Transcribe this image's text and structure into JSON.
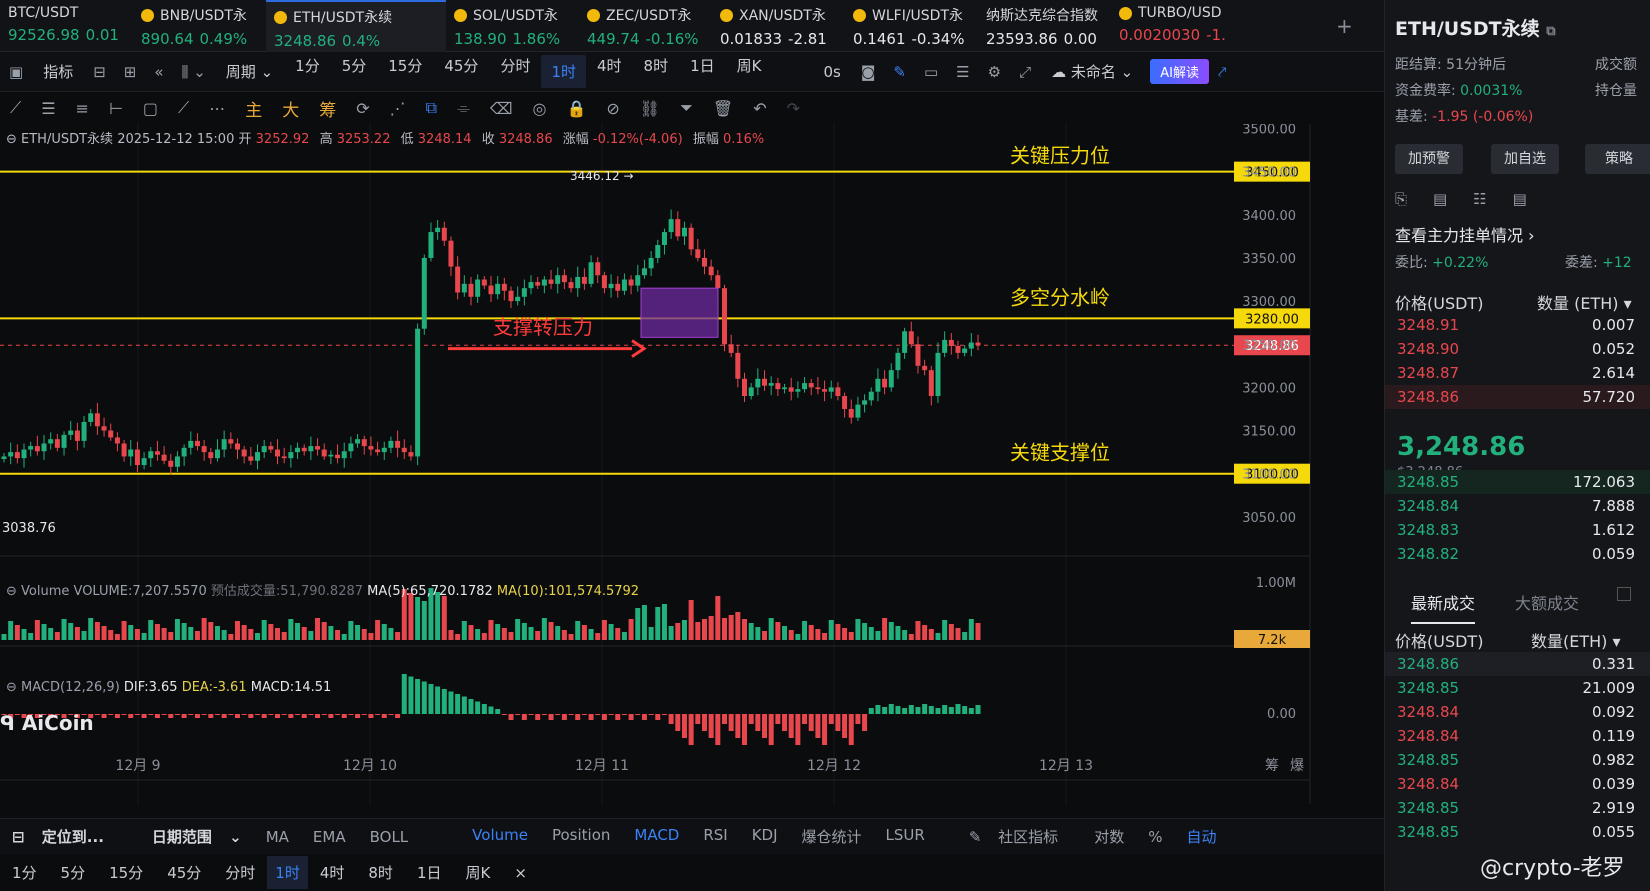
{
  "tickers": [
    {
      "name": "BTC/USDT",
      "price": "92526.98",
      "change": "0.01",
      "dir": "up"
    },
    {
      "name": "BNB/USDT永",
      "price": "890.64",
      "change": "0.49%",
      "dir": "up"
    },
    {
      "name": "ETH/USDT永续",
      "price": "3248.86",
      "change": "0.4%",
      "dir": "up"
    },
    {
      "name": "SOL/USDT永",
      "price": "138.90",
      "change": "1.86%",
      "dir": "up"
    },
    {
      "name": "ZEC/USDT永",
      "price": "449.74",
      "change": "-0.16%",
      "dir": "up"
    },
    {
      "name": "XAN/USDT永",
      "price": "0.01833",
      "change": "-2.81",
      "dir": "wh"
    },
    {
      "name": "WLFI/USDT永",
      "price": "0.1461",
      "change": "-0.34%",
      "dir": "wh"
    },
    {
      "name": "纳斯达克综合指数",
      "price": "23593.86",
      "change": "0.00",
      "dir": "wh"
    },
    {
      "name": "TURBO/USD",
      "price": "0.0020030",
      "change": "-1.",
      "dir": "dn"
    }
  ],
  "toolbar1": {
    "indicator": "指标",
    "period": "周期",
    "intervals": [
      "1分",
      "5分",
      "15分",
      "45分",
      "分时",
      "1时",
      "4时",
      "8时",
      "1日",
      "周K"
    ],
    "selected": "1时",
    "countdown": "0s",
    "unnamed": "未命名",
    "ai": "AI解读"
  },
  "toolbar2": {
    "main": "主",
    "big": "大",
    "chips": "筹"
  },
  "info": {
    "symbol": "ETH/USDT永续",
    "datetime": "2025-12-12 15:00",
    "open_l": "开",
    "open": "3252.92",
    "high_l": "高",
    "high": "3253.22",
    "low_l": "低",
    "low": "3248.14",
    "close_l": "收",
    "close": "3248.86",
    "chg_l": "涨幅",
    "chg": "-0.12%(-4.06)",
    "amp_l": "振幅",
    "amp": "0.16%"
  },
  "volume": {
    "label": "Volume",
    "vol": "VOLUME:7,207.5570",
    "est": "预估成交量:51,790.8287",
    "ma5": "MA(5):65,720.1782",
    "ma10": "MA(10):101,574.5792",
    "axis": "1.00M",
    "last": "7.2k"
  },
  "macd": {
    "label": "MACD(12,26,9)",
    "dif": "DIF:3.65",
    "dea": "DEA:-3.61",
    "macd": "MACD:14.51",
    "axis": "0.00"
  },
  "annotations": {
    "resistance": "关键压力位",
    "pivot": "多空分水岭",
    "support": "关键支撑位",
    "flip": "支撑转压力",
    "high_mark": "3446.12 →",
    "low_mark": "3038.76"
  },
  "levels": {
    "resistance": "3450.00",
    "pivot": "3280.00",
    "current": "3248.86",
    "support": "3100.00"
  },
  "price_ticks": [
    "3500.00",
    "3450.00",
    "3400.00",
    "3350.00",
    "3300.00",
    "3250.00",
    "3200.00",
    "3150.00",
    "3100.00",
    "3050.00"
  ],
  "date_ticks": [
    "12月 9",
    "12月 10",
    "12月 11",
    "12月 12",
    "12月 13"
  ],
  "logo": "AiCoin",
  "bottom1": {
    "locate": "定位到...",
    "range": "日期范围",
    "ind": [
      "MA",
      "EMA",
      "BOLL"
    ],
    "sub": [
      "Volume",
      "Position",
      "MACD",
      "RSI",
      "KDJ",
      "爆仓统计",
      "LSUR"
    ],
    "community": "社区指标",
    "log": "对数",
    "pct": "%",
    "auto": "自动",
    "chips": "筹",
    "liq": "爆"
  },
  "bottom2": {
    "intervals": [
      "1分",
      "5分",
      "15分",
      "45分",
      "分时",
      "1时",
      "4时",
      "8时",
      "1日",
      "周K"
    ],
    "selected": "1时"
  },
  "right": {
    "symbol": "ETH/USDT永续",
    "settle": "距结算: 51分钟后",
    "vol_label": "成交额",
    "funding_l": "资金费率:",
    "funding": "0.0031%",
    "oi_label": "持仓量",
    "basis_l": "基差:",
    "basis": "-1.95 (-0.06%)",
    "buttons": [
      "加预警",
      "加自选",
      "策略"
    ],
    "depth_title": "查看主力挂单情况",
    "ratio_l": "委比:",
    "ratio": "+0.22%",
    "diff_l": "委差:",
    "diff": "+12",
    "col_price": "价格(USDT)",
    "col_qty": "数量 (ETH)",
    "asks": [
      {
        "p": "3248.91",
        "q": "0.007"
      },
      {
        "p": "3248.90",
        "q": "0.052"
      },
      {
        "p": "3248.87",
        "q": "2.614"
      },
      {
        "p": "3248.86",
        "q": "57.720"
      }
    ],
    "last": "3,248.86",
    "last_sub": "$3,248.86",
    "bids": [
      {
        "p": "3248.85",
        "q": "172.063"
      },
      {
        "p": "3248.84",
        "q": "7.888"
      },
      {
        "p": "3248.83",
        "q": "1.612"
      },
      {
        "p": "3248.82",
        "q": "0.059"
      }
    ],
    "trades_tab": "最新成交",
    "big_tab": "大额成交",
    "t_price": "价格(USDT)",
    "t_qty": "数量(ETH)",
    "trades": [
      {
        "p": "3248.86",
        "q": "0.331",
        "s": "up"
      },
      {
        "p": "3248.85",
        "q": "21.009",
        "s": "up"
      },
      {
        "p": "3248.84",
        "q": "0.092",
        "s": "dn"
      },
      {
        "p": "3248.84",
        "q": "0.119",
        "s": "dn"
      },
      {
        "p": "3248.85",
        "q": "0.982",
        "s": "up"
      },
      {
        "p": "3248.84",
        "q": "0.039",
        "s": "dn"
      },
      {
        "p": "3248.85",
        "q": "2.919",
        "s": "up"
      },
      {
        "p": "3248.85",
        "q": "0.055",
        "s": "up"
      }
    ]
  },
  "watermark": "@crypto-老罗",
  "colors": {
    "up": "#22b07d",
    "down": "#e8474d",
    "level": "#f5d90a",
    "accent": "#3b82f6"
  }
}
